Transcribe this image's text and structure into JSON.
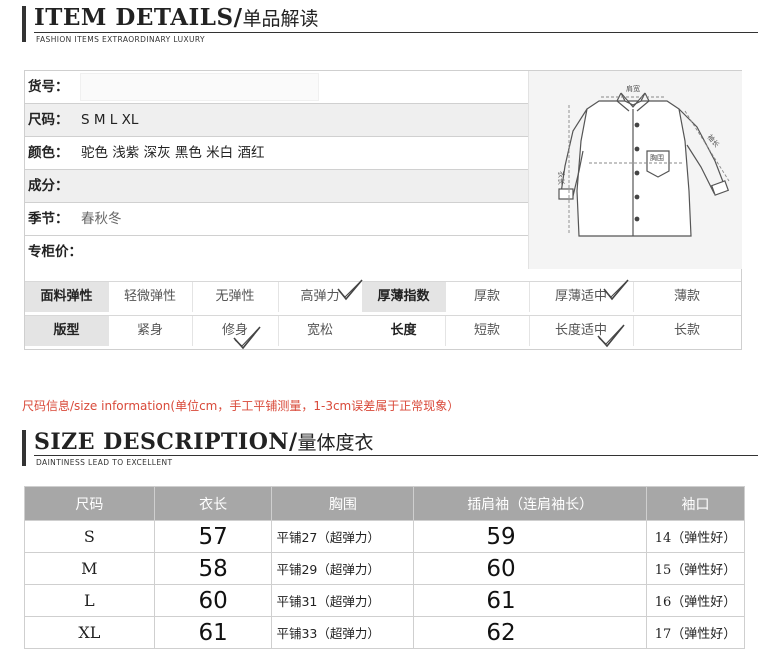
{
  "item_header": {
    "title_en": "ITEM DETAILS/",
    "title_cn": "单品解读",
    "subtitle": "FASHION ITEMS EXTRAORDINARY LUXURY"
  },
  "info_rows": [
    {
      "label": "货号：",
      "value": ""
    },
    {
      "label": "尺码：",
      "value": "S M L XL"
    },
    {
      "label": "颜色：",
      "value": "驼色 浅紫 深灰 黑色 米白 酒红"
    },
    {
      "label": "成分：",
      "value": ""
    },
    {
      "label": "季节：",
      "value": "春秋冬"
    },
    {
      "label": "专柜价：",
      "value": ""
    }
  ],
  "shirt_diagram": {
    "shoulder_label": "肩宽",
    "length_label": "衣长",
    "chest_label": "胸围",
    "sleeve_label": "袖长"
  },
  "attributes": {
    "row1": {
      "label": "面料弹性",
      "options": [
        "轻微弹性",
        "无弹性",
        "高弹力"
      ],
      "checked": "高弹力",
      "label2": "厚薄指数",
      "options2": [
        "厚款",
        "厚薄适中",
        "薄款"
      ],
      "checked2": "厚薄适中"
    },
    "row2": {
      "label": "版型",
      "options": [
        "紧身",
        "修身",
        "宽松"
      ],
      "checked": "修身",
      "label2": "长度",
      "options2": [
        "短款",
        "长度适中",
        "长款"
      ],
      "checked2": "长度适中"
    }
  },
  "size_note": "尺码信息/size information(单位cm，手工平铺测量，1-3cm误差属于正常现象）",
  "size_header": {
    "title_en": "SIZE DESCRIPTION/",
    "title_cn": "量体度衣",
    "subtitle": "DAINTINESS LEAD TO EXCELLENT"
  },
  "size_table": {
    "columns": [
      "尺码",
      "衣长",
      "胸围",
      "插肩袖（连肩袖长）",
      "袖口"
    ],
    "rows": [
      {
        "size": "S",
        "length": "57",
        "chest": "平铺27（超弹力）",
        "sleeve": "59",
        "cuff": "14（弹性好）"
      },
      {
        "size": "M",
        "length": "58",
        "chest": "平铺29（超弹力）",
        "sleeve": "60",
        "cuff": "15（弹性好）"
      },
      {
        "size": "L",
        "length": "60",
        "chest": "平铺31（超弹力）",
        "sleeve": "61",
        "cuff": "16（弹性好）"
      },
      {
        "size": "XL",
        "length": "61",
        "chest": "平铺33（超弹力）",
        "sleeve": "62",
        "cuff": "17（弹性好）"
      }
    ]
  },
  "colors": {
    "note_red": "#d94a3a",
    "table_header_gray": "#a7a7a7",
    "check_gray": "#444444"
  }
}
